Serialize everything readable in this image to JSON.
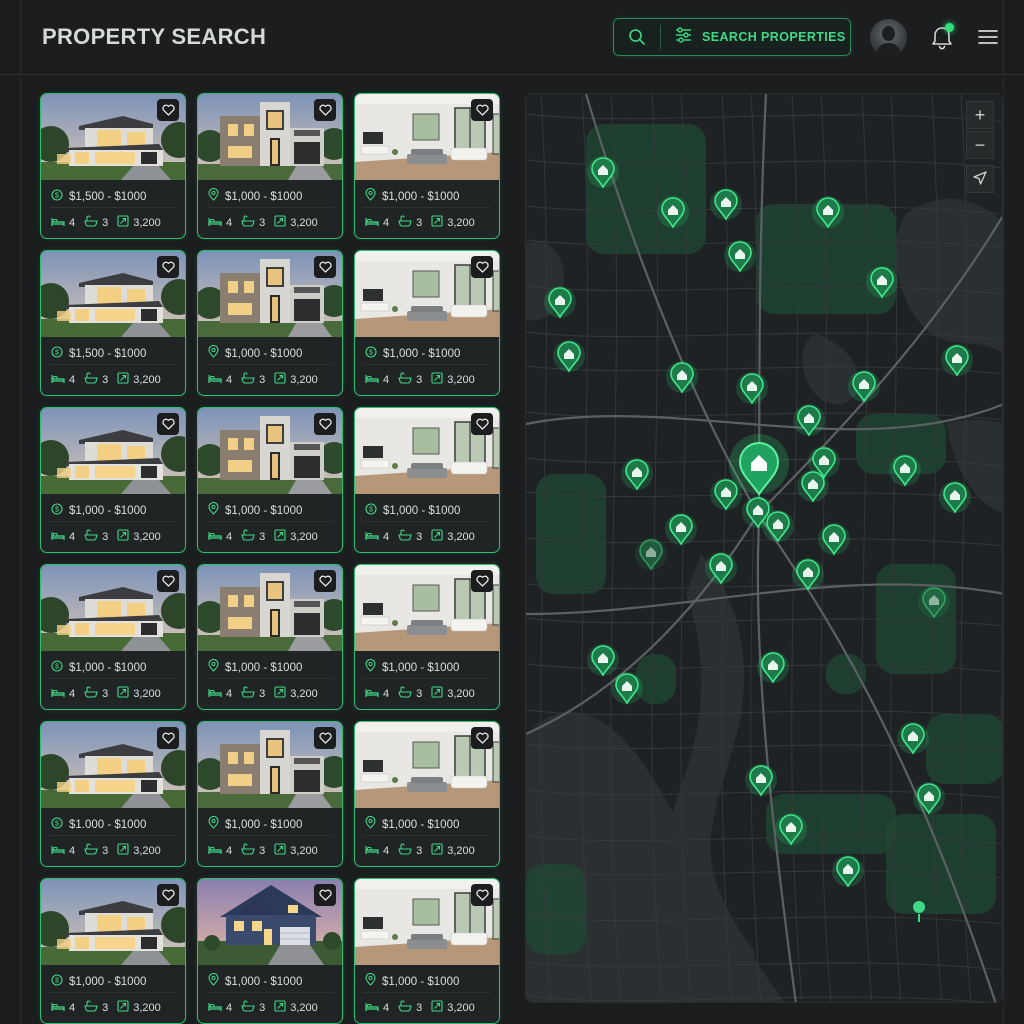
{
  "header": {
    "title": "PROPERTY SEARCH",
    "search_button_label": "SEARCH PROPERTIES",
    "search_icon": "search-icon",
    "filter_icon": "sliders-icon",
    "notification_icon": "bell-icon",
    "menu_icon": "hamburger-icon"
  },
  "listings": [
    {
      "type": "modern",
      "price": "$1,500 - $1000",
      "price_icon": "dollar-coin-icon",
      "beds": "4",
      "baths": "3",
      "area": "3,200"
    },
    {
      "type": "townhouse",
      "price": "$1,000 - $1000",
      "price_icon": "location-pin-icon",
      "beds": "4",
      "baths": "3",
      "area": "3,200"
    },
    {
      "type": "interior",
      "price": "$1,000 - $1000",
      "price_icon": "location-pin-icon",
      "beds": "4",
      "baths": "3",
      "area": "3,200"
    },
    {
      "type": "modern",
      "price": "$1,500 - $1000",
      "price_icon": "dollar-coin-icon",
      "beds": "4",
      "baths": "3",
      "area": "3,200"
    },
    {
      "type": "townhouse",
      "price": "$1,000 - $1000",
      "price_icon": "location-pin-icon",
      "beds": "4",
      "baths": "3",
      "area": "3,200"
    },
    {
      "type": "interior",
      "price": "$1,000 - $1000",
      "price_icon": "dollar-coin-icon",
      "beds": "4",
      "baths": "3",
      "area": "3,200"
    },
    {
      "type": "modern",
      "price": "$1,000 - $1000",
      "price_icon": "dollar-coin-icon",
      "beds": "4",
      "baths": "3",
      "area": "3,200"
    },
    {
      "type": "townhouse",
      "price": "$1,000 - $1000",
      "price_icon": "location-pin-icon",
      "beds": "4",
      "baths": "3",
      "area": "3,200"
    },
    {
      "type": "interior",
      "price": "$1,000 - $1000",
      "price_icon": "dollar-coin-icon",
      "beds": "4",
      "baths": "3",
      "area": "3,200"
    },
    {
      "type": "modern",
      "price": "$1,000 - $1000",
      "price_icon": "dollar-coin-icon",
      "beds": "4",
      "baths": "3",
      "area": "3,200"
    },
    {
      "type": "townhouse",
      "price": "$1,000 - $1000",
      "price_icon": "location-pin-icon",
      "beds": "4",
      "baths": "3",
      "area": "3,200"
    },
    {
      "type": "interior",
      "price": "$1,000 - $1000",
      "price_icon": "location-pin-icon",
      "beds": "4",
      "baths": "3",
      "area": "3,200"
    },
    {
      "type": "modern",
      "price": "$1.000 - $1000",
      "price_icon": "dollar-coin-icon",
      "beds": "4",
      "baths": "3",
      "area": "3,200"
    },
    {
      "type": "townhouse",
      "price": "$1,000 - $1000",
      "price_icon": "location-pin-icon",
      "beds": "4",
      "baths": "3",
      "area": "3,200"
    },
    {
      "type": "interior",
      "price": "$1,000 - $1000",
      "price_icon": "location-pin-icon",
      "beds": "4",
      "baths": "3",
      "area": "3,200"
    },
    {
      "type": "modern",
      "price": "$1,000 - $1000",
      "price_icon": "dollar-coin-icon",
      "beds": "4",
      "baths": "3",
      "area": "3,200"
    },
    {
      "type": "suburban",
      "price": "$1,000 - $1000",
      "price_icon": "location-pin-icon",
      "beds": "4",
      "baths": "3",
      "area": "3,200"
    },
    {
      "type": "interior",
      "price": "$1,000 - $1000",
      "price_icon": "location-pin-icon",
      "beds": "4",
      "baths": "3",
      "area": "3,200"
    }
  ],
  "card_icons": {
    "favorite": "heart-icon",
    "beds": "bed-icon",
    "baths": "bathtub-icon",
    "area": "area-icon"
  },
  "map": {
    "controls": [
      {
        "name": "zoom-in-button",
        "label": "+"
      },
      {
        "name": "zoom-out-button",
        "label": "−"
      },
      {
        "name": "locate-button",
        "icon": "navigation-arrow-icon"
      }
    ],
    "pin_count": 38
  },
  "colors": {
    "accent": "#3fd987",
    "card_border": "#2fbf73",
    "background": "#1b1d1e",
    "map_land": "#1f2224",
    "map_park": "#1f4a33",
    "map_water": "#2a2f31"
  }
}
